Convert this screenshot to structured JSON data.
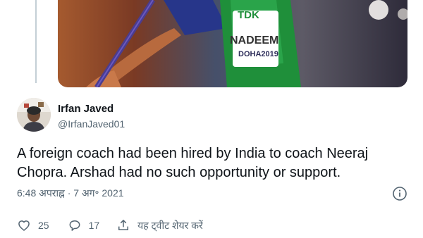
{
  "media": {
    "bib_brand": "TDK",
    "bib_name": "NADEEM",
    "bib_event": "DOHA2019"
  },
  "author": {
    "name": "Irfan Javed",
    "handle": "@IrfanJaved01"
  },
  "tweet": {
    "text": "A foreign coach had been hired by India to coach Neeraj Chopra. Arshad had no such opportunity or support.",
    "timestamp": "6:48 अपराह्न · 7 अग॰ 2021"
  },
  "actions": {
    "likes": "25",
    "replies": "17",
    "share_label": "यह ट्वीट शेयर करें"
  },
  "colors": {
    "text_primary": "#0f1419",
    "text_secondary": "#536471",
    "thread_line": "#c4cfd6"
  }
}
